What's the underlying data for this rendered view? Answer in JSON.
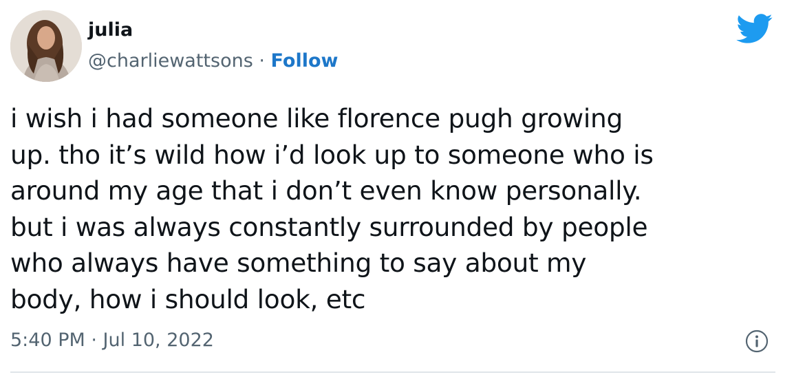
{
  "user": {
    "display_name": "julia",
    "handle": "@charliewattsons",
    "separator": " · ",
    "follow_label": "Follow"
  },
  "tweet": {
    "text": "i wish i had someone like florence pugh growing\nup. tho it’s wild how i’d look up to someone who is\naround my age that i don’t even know personally.\nbut i was always constantly surrounded by people\nwho always have something to say about my\nbody, how i should look, etc",
    "timestamp": "5:40 PM · Jul 10, 2022"
  },
  "icons": {
    "brand": "twitter-bird-icon",
    "info": "info-icon",
    "brand_color": "#1d9bf0",
    "follow_color": "#1d77c9"
  }
}
